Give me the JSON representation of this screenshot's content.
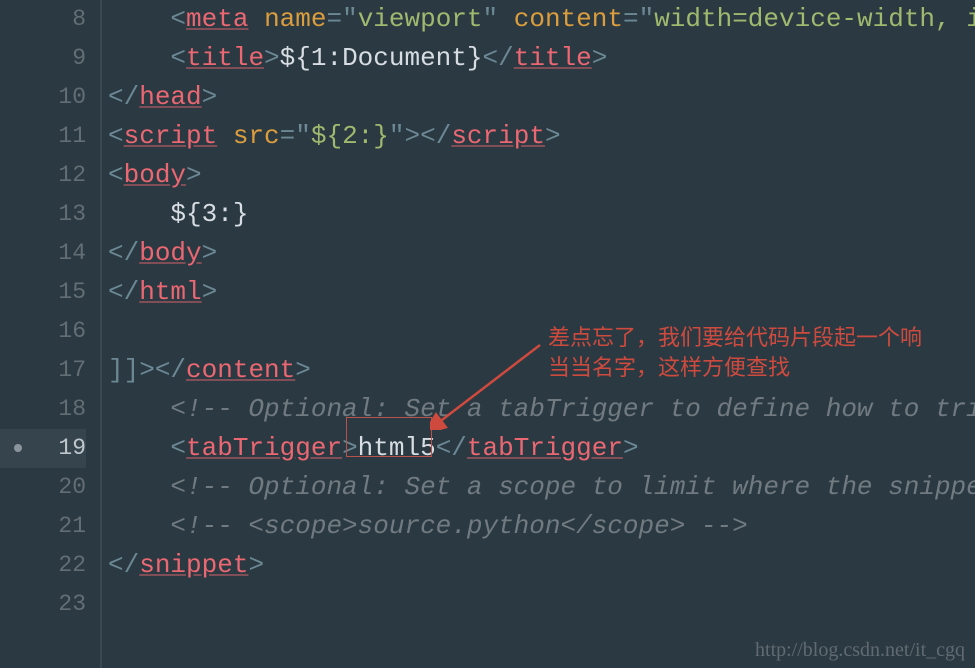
{
  "gutter": [
    "8",
    "9",
    "10",
    "11",
    "12",
    "13",
    "14",
    "15",
    "16",
    "17",
    "18",
    "19",
    "20",
    "21",
    "22",
    "23"
  ],
  "current_line_index": 11,
  "code": {
    "l8": {
      "ind": "    ",
      "o": "<",
      "tag": "meta",
      "sp": " ",
      "attr1": "name",
      "eq1": "=\"",
      "v1": "viewport",
      "q1": "\"",
      "sp2": " ",
      "attr2": "content",
      "eq2": "=\"",
      "v2": "width=device-width, ini",
      "tail": ""
    },
    "l9": {
      "ind": "    ",
      "o": "<",
      "tag": "title",
      "c": ">",
      "txt": "${1:Document}",
      "oc": "</",
      "cc": ">"
    },
    "l10": {
      "oc": "</",
      "tag": "head",
      "cc": ">"
    },
    "l11": {
      "o": "<",
      "tag": "script",
      "sp": " ",
      "attr": "src",
      "eq": "=\"",
      "v": "${2:}",
      "q": "\"",
      "c": ">",
      "oc": "</",
      "cc": ">"
    },
    "l12": {
      "o": "<",
      "tag": "body",
      "c": ">"
    },
    "l13": {
      "ind": "    ",
      "txt": "${3:}"
    },
    "l14": {
      "oc": "</",
      "tag": "body",
      "cc": ">"
    },
    "l15": {
      "oc": "</",
      "tag": "html",
      "cc": ">"
    },
    "l17": {
      "pre": "]]>",
      "oc": "</",
      "tag": "content",
      "cc": ">"
    },
    "l18": {
      "ind": "    ",
      "cm": "<!-- Optional: Set a tabTrigger to define how to trigg"
    },
    "l19": {
      "ind": "    ",
      "o": "<",
      "tag": "tabTrigger",
      "c": ">",
      "txt": "html5",
      "oc": "</",
      "cc": ">"
    },
    "l20": {
      "ind": "    ",
      "cm": "<!-- Optional: Set a scope to limit where the snippet "
    },
    "l21": {
      "ind": "    ",
      "cm": "<!-- <scope>source.python</scope> -->"
    },
    "l22": {
      "oc": "</",
      "tag": "snippet",
      "cc": ">"
    }
  },
  "annotation": {
    "line1": "差点忘了，我们要给代码片段起一个响",
    "line2": "当当名字，这样方便查找"
  },
  "watermark": "http://blog.csdn.net/it_cgq"
}
